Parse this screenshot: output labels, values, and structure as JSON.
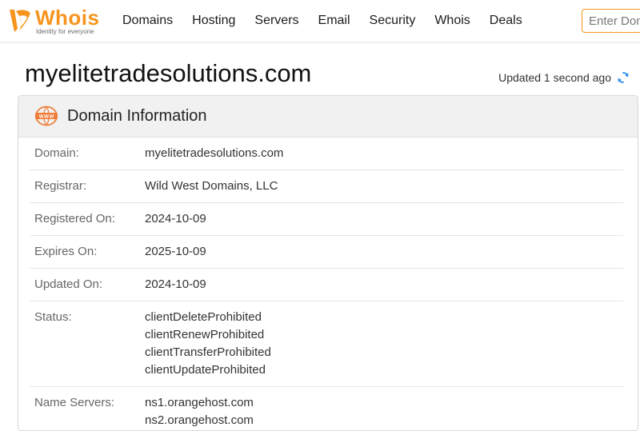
{
  "header": {
    "logo_word": "Whois",
    "logo_tagline": "Identity for everyone",
    "nav": [
      "Domains",
      "Hosting",
      "Servers",
      "Email",
      "Security",
      "Whois",
      "Deals"
    ],
    "search_placeholder": "Enter Domain"
  },
  "page": {
    "title": "myelitetradesolutions.com",
    "updated_text": "Updated 1 second ago"
  },
  "card": {
    "title": "Domain Information",
    "icon": "www-icon",
    "rows": [
      {
        "label": "Domain:",
        "values": [
          "myelitetradesolutions.com"
        ]
      },
      {
        "label": "Registrar:",
        "values": [
          "Wild West Domains, LLC"
        ]
      },
      {
        "label": "Registered On:",
        "values": [
          "2024-10-09"
        ]
      },
      {
        "label": "Expires On:",
        "values": [
          "2025-10-09"
        ]
      },
      {
        "label": "Updated On:",
        "values": [
          "2024-10-09"
        ]
      },
      {
        "label": "Status:",
        "values": [
          "clientDeleteProhibited",
          "clientRenewProhibited",
          "clientTransferProhibited",
          "clientUpdateProhibited"
        ]
      },
      {
        "label": "Name Servers:",
        "values": [
          "ns1.orangehost.com",
          "ns2.orangehost.com"
        ]
      }
    ]
  },
  "colors": {
    "brand": "#f7941d",
    "refresh": "#1e88e5"
  }
}
